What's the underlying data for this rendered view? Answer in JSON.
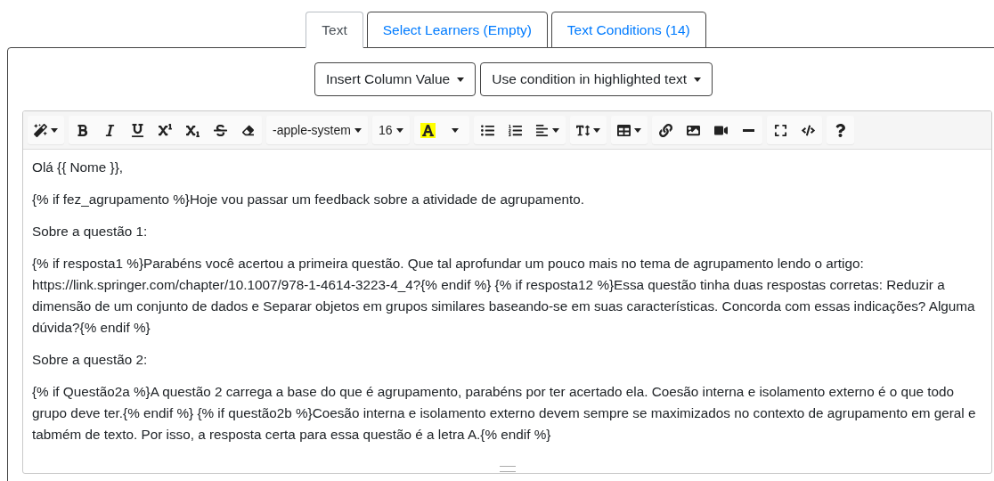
{
  "tabs": [
    {
      "label": "Text",
      "selected": true
    },
    {
      "label": "Select Learners (Empty)",
      "selected": false
    },
    {
      "label": "Text Conditions (14)",
      "selected": false
    }
  ],
  "dropdowns": [
    "Insert Column Value",
    "Use condition in highlighted text"
  ],
  "toolbar": {
    "font": "-apple-system",
    "size": "16"
  },
  "paragraphs": [
    "Olá {{ Nome }},",
    "{% if fez_agrupamento %}Hoje vou passar um feedback sobre a atividade de agrupamento.",
    "Sobre a questão 1:",
    "{% if resposta1 %}Parabéns você acertou a primeira questão. Que tal aprofundar um pouco mais no tema de agrupamento lendo o artigo: https://link.springer.com/chapter/10.1007/978-1-4614-3223-4_4?{% endif %} {% if resposta12 %}Essa questão tinha duas respostas corretas: Reduzir a dimensão de um conjunto de dados e Separar objetos em grupos similares baseando-se em suas características. Concorda com essas indicações? Alguma dúvida?{% endif %}",
    "Sobre a questão 2:",
    "{% if Questão2a %}A questão 2 carrega a base do que é agrupamento, parabéns por ter acertado ela. Coesão interna e isolamento externo é o que todo grupo deve ter.{% endif %} {% if questão2b %}Coesão interna e isolamento externo devem sempre se maximizados no contexto de agrupamento em geral e tabmém de texto. Por isso, a resposta certa para essa questão é a letra A.{% endif %}"
  ]
}
